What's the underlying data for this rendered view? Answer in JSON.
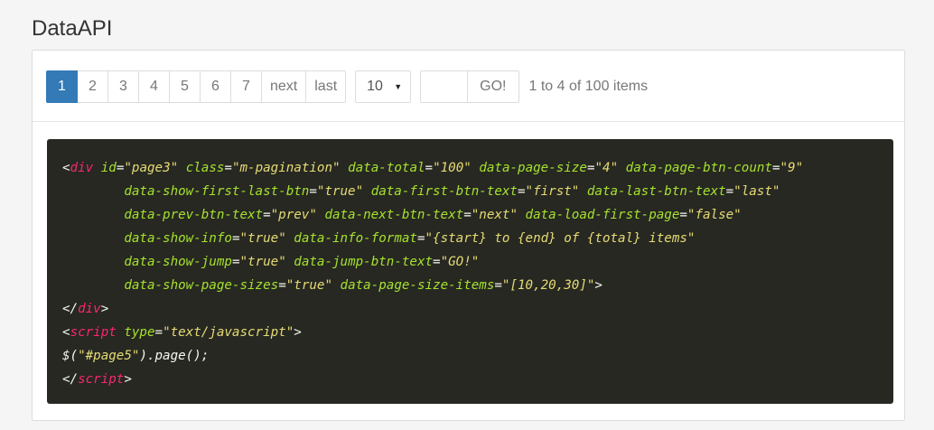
{
  "page": {
    "title": "DataAPI"
  },
  "pagination": {
    "pages": [
      "1",
      "2",
      "3",
      "4",
      "5",
      "6",
      "7"
    ],
    "active_page": "1",
    "next_label": "next",
    "last_label": "last",
    "page_size_selected": "10",
    "jump_input_value": "",
    "jump_button_label": "GO!",
    "info_text": "1 to 4 of 100 items"
  },
  "code": {
    "line1": {
      "indent": "",
      "tag_open": "<",
      "tag_name": "div",
      "attrs": [
        {
          "name": "id",
          "value": "\"page3\""
        },
        {
          "name": "class",
          "value": "\"m-pagination\""
        },
        {
          "name": "data-total",
          "value": "\"100\""
        },
        {
          "name": "data-page-size",
          "value": "\"4\""
        },
        {
          "name": "data-page-btn-count",
          "value": "\"9\""
        }
      ]
    },
    "line2": {
      "indent": "        ",
      "attrs": [
        {
          "name": "data-show-first-last-btn",
          "value": "\"true\""
        },
        {
          "name": "data-first-btn-text",
          "value": "\"first\""
        },
        {
          "name": "data-last-btn-text",
          "value": "\"last\""
        }
      ]
    },
    "line3": {
      "indent": "        ",
      "attrs": [
        {
          "name": "data-prev-btn-text",
          "value": "\"prev\""
        },
        {
          "name": "data-next-btn-text",
          "value": "\"next\""
        },
        {
          "name": "data-load-first-page",
          "value": "\"false\""
        }
      ]
    },
    "line4": {
      "indent": "        ",
      "attrs": [
        {
          "name": "data-show-info",
          "value": "\"true\""
        },
        {
          "name": "data-info-format",
          "value": "\"{start} to {end} of {total} items\""
        }
      ]
    },
    "line5": {
      "indent": "        ",
      "attrs": [
        {
          "name": "data-show-jump",
          "value": "\"true\""
        },
        {
          "name": "data-jump-btn-text",
          "value": "\"GO!\""
        }
      ]
    },
    "line6": {
      "indent": "        ",
      "attrs": [
        {
          "name": "data-show-page-sizes",
          "value": "\"true\""
        },
        {
          "name": "data-page-size-items",
          "value": "\"[10,20,30]\""
        }
      ],
      "tail": ">"
    },
    "line7": {
      "open": "</",
      "tag": "div",
      "close": ">"
    },
    "line8": {
      "open": "<",
      "tag": "script",
      "attr_name": "type",
      "attr_value": "\"text/javascript\"",
      "close": ">"
    },
    "line9": {
      "prefix": "$(",
      "string": "\"#page5\"",
      "suffix": ").page();"
    },
    "line10": {
      "open": "</",
      "tag": "script",
      "close": ">"
    }
  },
  "colors": {
    "active_page_bg": "#337ab7",
    "code_bg": "#272822",
    "code_tag": "#f92672",
    "code_attr": "#a6e22e",
    "code_string": "#e6db74"
  }
}
